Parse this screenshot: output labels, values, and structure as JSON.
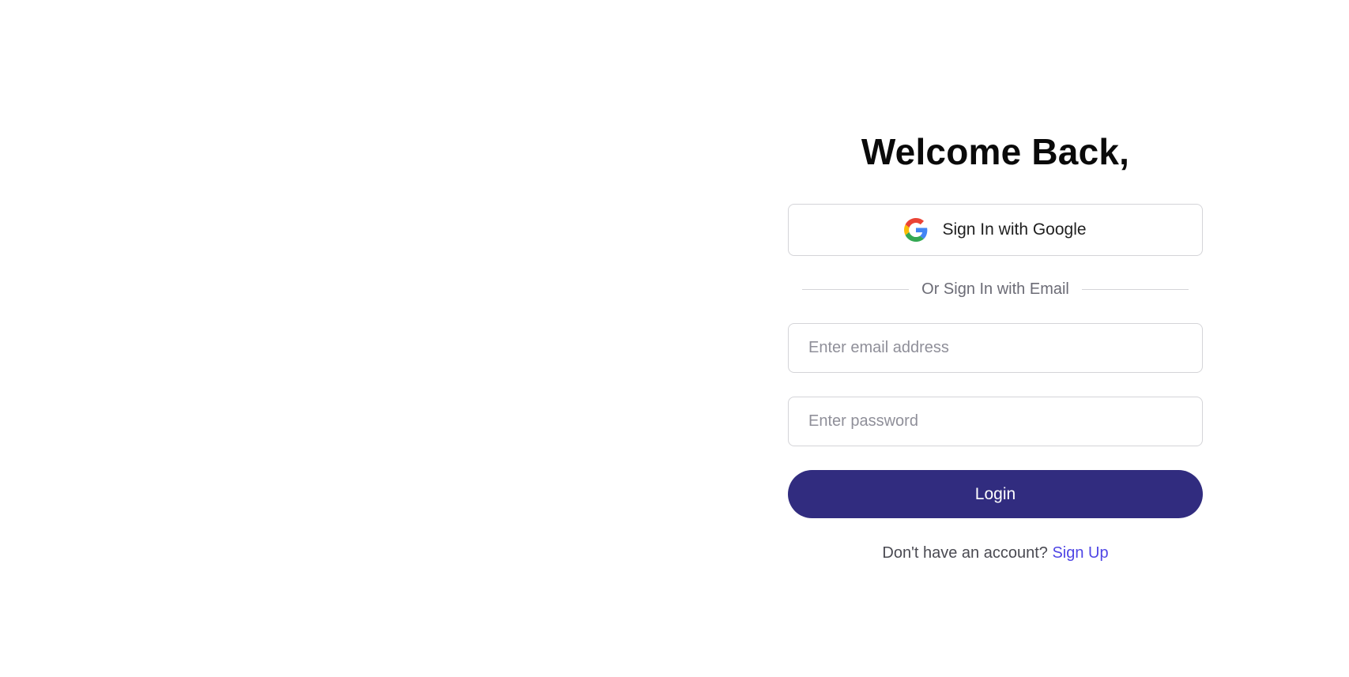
{
  "auth": {
    "heading": "Welcome Back,",
    "google_button_label": "Sign In with Google",
    "google_icon": "google-g-icon",
    "divider_text": "Or Sign In with Email",
    "email": {
      "placeholder": "Enter email address",
      "value": ""
    },
    "password": {
      "placeholder": "Enter password",
      "value": ""
    },
    "login_label": "Login",
    "signup_prompt": "Don't have an account?",
    "signup_link": "Sign Up"
  },
  "colors": {
    "primary_button": "#312c7f",
    "link": "#4f46e5",
    "border": "#d4d4d8",
    "heading_text": "#0a0a0a",
    "muted_text": "#6b6b75"
  }
}
